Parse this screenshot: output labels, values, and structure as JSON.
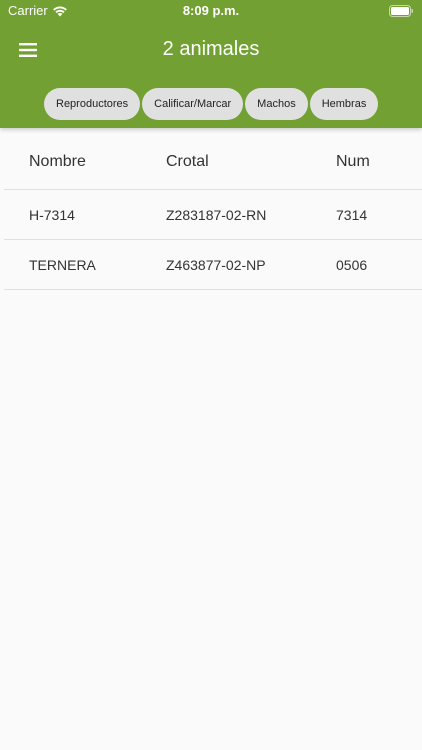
{
  "status_bar": {
    "carrier": "Carrier",
    "time": "8:09 p.m."
  },
  "app_bar": {
    "title": "2 animales"
  },
  "filters": [
    {
      "label": "Reproductores"
    },
    {
      "label": "Calificar/Marcar"
    },
    {
      "label": "Machos"
    },
    {
      "label": "Hembras"
    }
  ],
  "table": {
    "headers": [
      "Nombre",
      "Crotal",
      "Num"
    ],
    "rows": [
      [
        "H-7314",
        "Z283187-02-RN",
        "7314"
      ],
      [
        "TERNERA",
        "Z463877-02-NP",
        "0506"
      ]
    ]
  },
  "colors": {
    "app_bar": "#72a032",
    "chip": "#e0e0e0",
    "background": "#fafafa"
  }
}
